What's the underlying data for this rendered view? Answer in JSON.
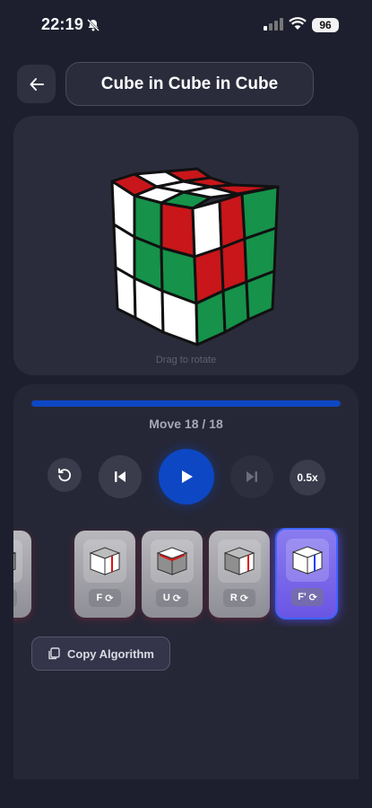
{
  "status": {
    "time": "22:19",
    "battery": "96"
  },
  "header": {
    "title": "Cube in Cube in Cube"
  },
  "viewer": {
    "hint": "Drag to rotate"
  },
  "player": {
    "move_label": "Move 18 / 18",
    "progress": 1.0,
    "speed": "0.5x"
  },
  "moves": [
    {
      "label": "F'"
    },
    {
      "label": "F"
    },
    {
      "label": "U"
    },
    {
      "label": "R"
    },
    {
      "label": "F'"
    }
  ],
  "copy": {
    "label": "Copy Algorithm"
  },
  "colors": {
    "accent": "#0d47c4",
    "active_card": "#6a55e4"
  }
}
